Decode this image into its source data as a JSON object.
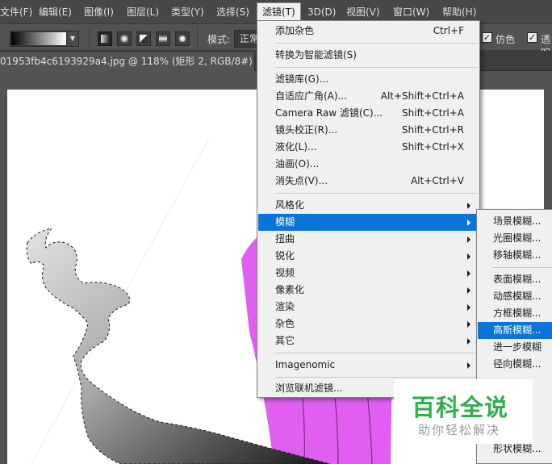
{
  "menubar": {
    "items": [
      "文件(F)",
      "编辑(E)",
      "图像(I)",
      "图层(L)",
      "类型(Y)",
      "选择(S)",
      "滤镜(T)",
      "3D(D)",
      "视图(V)",
      "窗口(W)",
      "帮助(H)"
    ]
  },
  "options": {
    "mode_label": "模式:",
    "mode_value": "正常",
    "dither_label": "仿色",
    "transparency_label": "透明"
  },
  "document": {
    "tab_title": "01953fb4c6193929a4.jpg @ 118% (矩形 2, RGB/8#) *",
    "close_glyph": "×"
  },
  "filter_menu": {
    "items": [
      {
        "label": "添加杂色",
        "shortcut": "Ctrl+F"
      },
      {
        "label": "转换为智能滤镜(S)",
        "shortcut": ""
      },
      {
        "label": "滤镜库(G)...",
        "shortcut": ""
      },
      {
        "label": "自适应广角(A)...",
        "shortcut": "Alt+Shift+Ctrl+A"
      },
      {
        "label": "Camera Raw 滤镜(C)...",
        "shortcut": "Shift+Ctrl+A"
      },
      {
        "label": "镜头校正(R)...",
        "shortcut": "Shift+Ctrl+R"
      },
      {
        "label": "液化(L)...",
        "shortcut": "Shift+Ctrl+X"
      },
      {
        "label": "油画(O)...",
        "shortcut": ""
      },
      {
        "label": "消失点(V)...",
        "shortcut": "Alt+Ctrl+V"
      },
      {
        "label": "风格化",
        "shortcut": ""
      },
      {
        "label": "模糊",
        "shortcut": ""
      },
      {
        "label": "扭曲",
        "shortcut": ""
      },
      {
        "label": "锐化",
        "shortcut": ""
      },
      {
        "label": "视频",
        "shortcut": ""
      },
      {
        "label": "像素化",
        "shortcut": ""
      },
      {
        "label": "渲染",
        "shortcut": ""
      },
      {
        "label": "杂色",
        "shortcut": ""
      },
      {
        "label": "其它",
        "shortcut": ""
      },
      {
        "label": "Imagenomic",
        "shortcut": ""
      },
      {
        "label": "浏览联机滤镜...",
        "shortcut": ""
      }
    ]
  },
  "blur_submenu": {
    "items": [
      "场景模糊...",
      "光圈模糊...",
      "移轴模糊...",
      "表面模糊...",
      "动感模糊...",
      "方框模糊...",
      "高斯模糊...",
      "进一步模糊",
      "径向模糊...",
      "形状模糊..."
    ]
  },
  "watermark": {
    "main": "百科全说",
    "sub": "助你轻松解决"
  },
  "colors": {
    "menu_highlight": "#0a74d8",
    "magenta_shape": "#e15ff0",
    "watermark_green": "#2eae4d"
  }
}
